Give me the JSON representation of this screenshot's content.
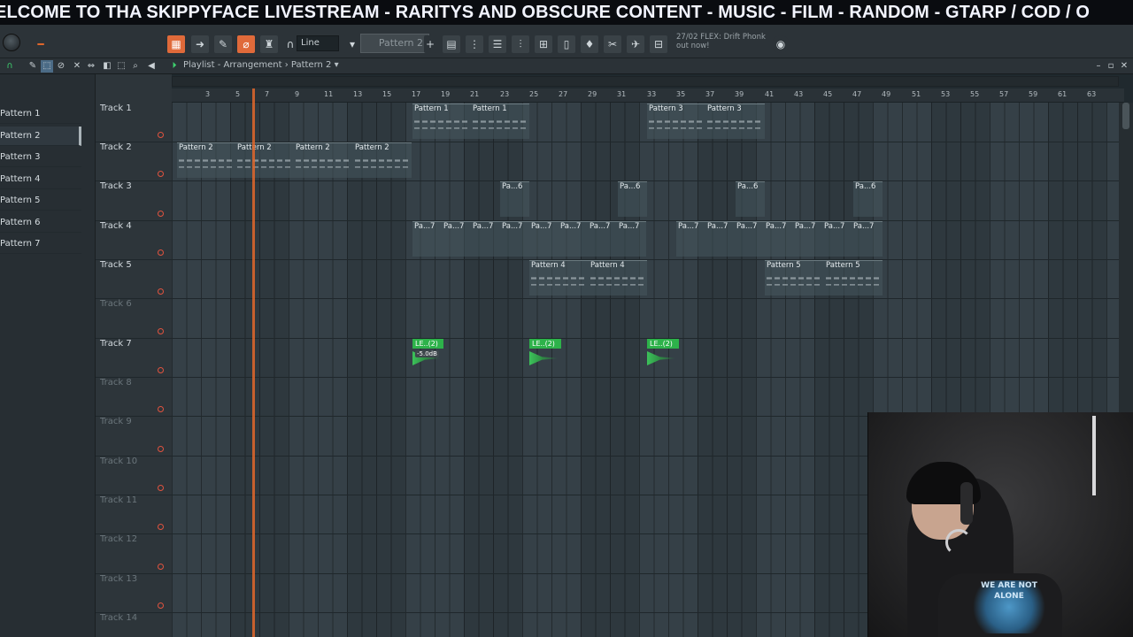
{
  "ticker": {
    "text": "ELCOME TO THA SKIPPYFACE LIVESTREAM  - RARITYS AND OBSCURE CONTENT - MUSIC - FILM - RANDOM - GTARP / COD / O"
  },
  "toolbar": {
    "snap_label": "Line",
    "pattern_selector": "Pattern 2",
    "add_label": "+",
    "news_line1": "27/02  FLEX: Drift Phonk",
    "news_line2": "out now!"
  },
  "playlist": {
    "title": "Playlist - Arrangement › Pattern 2 ▾",
    "pattern_list": [
      "Pattern 1",
      "Pattern 2",
      "Pattern 3",
      "Pattern 4",
      "Pattern 5",
      "Pattern 6",
      "Pattern 7"
    ],
    "selected_pattern": "Pattern 2",
    "ruler_bars": [
      "3",
      "5",
      "7",
      "9",
      "11",
      "13",
      "15",
      "17",
      "19",
      "21",
      "23",
      "25",
      "27",
      "29",
      "31",
      "33",
      "35",
      "37",
      "39",
      "41",
      "43",
      "45",
      "47",
      "49",
      "51",
      "53",
      "55",
      "57",
      "59",
      "61",
      "63"
    ],
    "tracks": [
      "Track 1",
      "Track 2",
      "Track 3",
      "Track 4",
      "Track 5",
      "Track 6",
      "Track 7",
      "Track 8",
      "Track 9",
      "Track 10",
      "Track 11",
      "Track 12",
      "Track 13",
      "Track 14"
    ],
    "clips": {
      "t1": [
        "Pattern 1",
        "Pattern 1",
        "Pattern 3",
        "Pattern 3"
      ],
      "t2": [
        "Pattern 2",
        "Pattern 2",
        "Pattern 2",
        "Pattern 2"
      ],
      "t3": [
        "Pa...6",
        "Pa...6",
        "Pa...6",
        "Pa...6"
      ],
      "t4_label": "Pa...7",
      "t5": [
        "Pattern 4",
        "Pattern 4",
        "Pattern 5",
        "Pattern 5"
      ],
      "t7": [
        "LE..(2)",
        "LE..(2)",
        "LE..(2)"
      ],
      "t7_volume": "-5.0dB"
    }
  },
  "webcam": {
    "shirt_text": "WE ARE NOT ALONE"
  },
  "colors": {
    "accent_orange": "#e0672b",
    "audio_green": "#2db24a",
    "record_red": "#e1533f"
  }
}
